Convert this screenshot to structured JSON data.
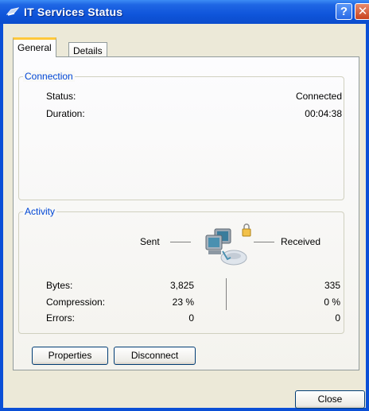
{
  "window": {
    "title": "IT Services Status"
  },
  "titlebar_buttons": {
    "help": "?",
    "close": "✕"
  },
  "tabs": [
    {
      "label": "General",
      "active": true
    },
    {
      "label": "Details",
      "active": false
    }
  ],
  "connection": {
    "title": "Connection",
    "status_label": "Status:",
    "status_value": "Connected",
    "duration_label": "Duration:",
    "duration_value": "00:04:38"
  },
  "activity": {
    "title": "Activity",
    "sent_label": "Sent",
    "received_label": "Received",
    "rows": [
      {
        "label": "Bytes:",
        "sent": "3,825",
        "received": "335"
      },
      {
        "label": "Compression:",
        "sent": "23 %",
        "received": "0 %"
      },
      {
        "label": "Errors:",
        "sent": "0",
        "received": "0"
      }
    ]
  },
  "buttons": {
    "properties": "Properties",
    "disconnect": "Disconnect",
    "close": "Close"
  },
  "colors": {
    "titlebar": "#0f55db",
    "group_title": "#0046d5",
    "tab_highlight": "#ffc83c"
  }
}
